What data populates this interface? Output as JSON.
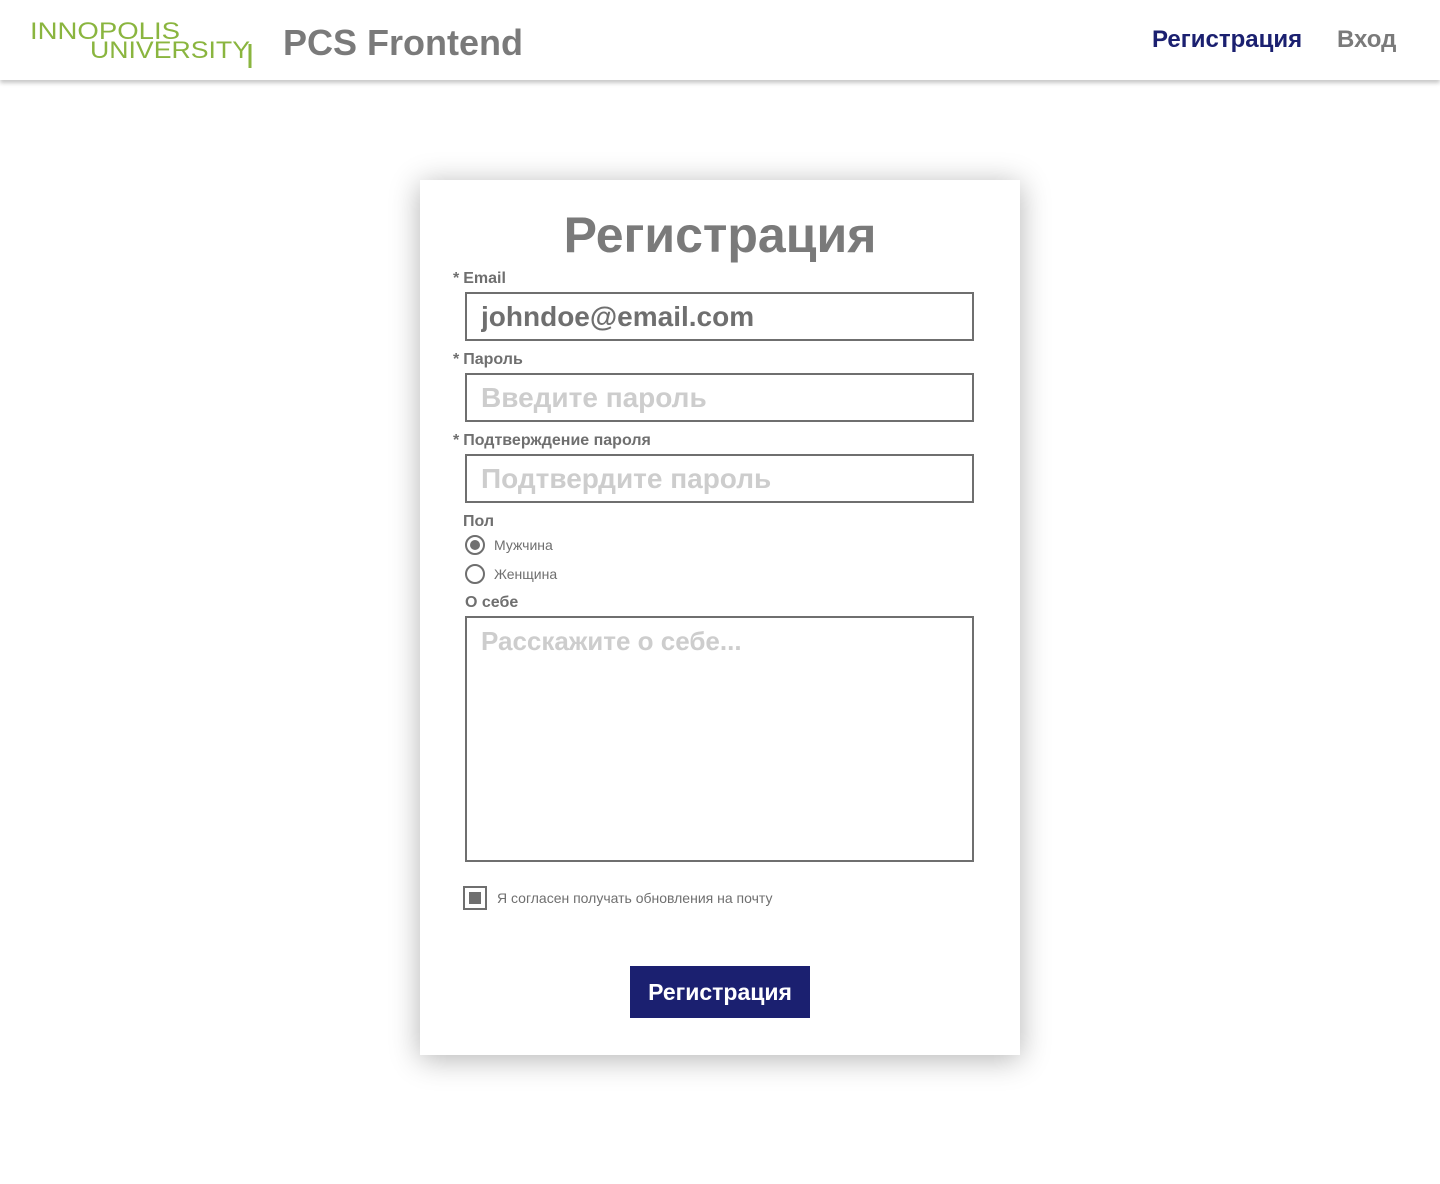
{
  "header": {
    "logo": {
      "line1": "INNOPOLIS",
      "line2": "UNIVERSITY",
      "color": "#8ab53f"
    },
    "app_title": "PCS Frontend",
    "nav": [
      {
        "label": "Регистрация",
        "active": true,
        "color": "#1b2070"
      },
      {
        "label": "Вход",
        "active": false,
        "color": "#7a7a7a"
      }
    ]
  },
  "form": {
    "title": "Регистрация",
    "required_mark": "*",
    "email": {
      "label": "Email",
      "value": "johndoe@email.com",
      "required": true
    },
    "password": {
      "label": "Пароль",
      "placeholder": "Введите пароль",
      "required": true
    },
    "confirm_password": {
      "label": "Подтверждение пароля",
      "placeholder": "Подтвердите пароль",
      "required": true
    },
    "gender": {
      "label": "Пол",
      "options": [
        {
          "label": "Мужчина",
          "checked": true
        },
        {
          "label": "Женщина",
          "checked": false
        }
      ]
    },
    "about": {
      "label": "О себе",
      "placeholder": "Расскажите о себе..."
    },
    "newsletter": {
      "label": "Я согласен получать обновления на почту",
      "checked": true
    },
    "submit_label": "Регистрация",
    "submit_color": "#1b2070"
  }
}
